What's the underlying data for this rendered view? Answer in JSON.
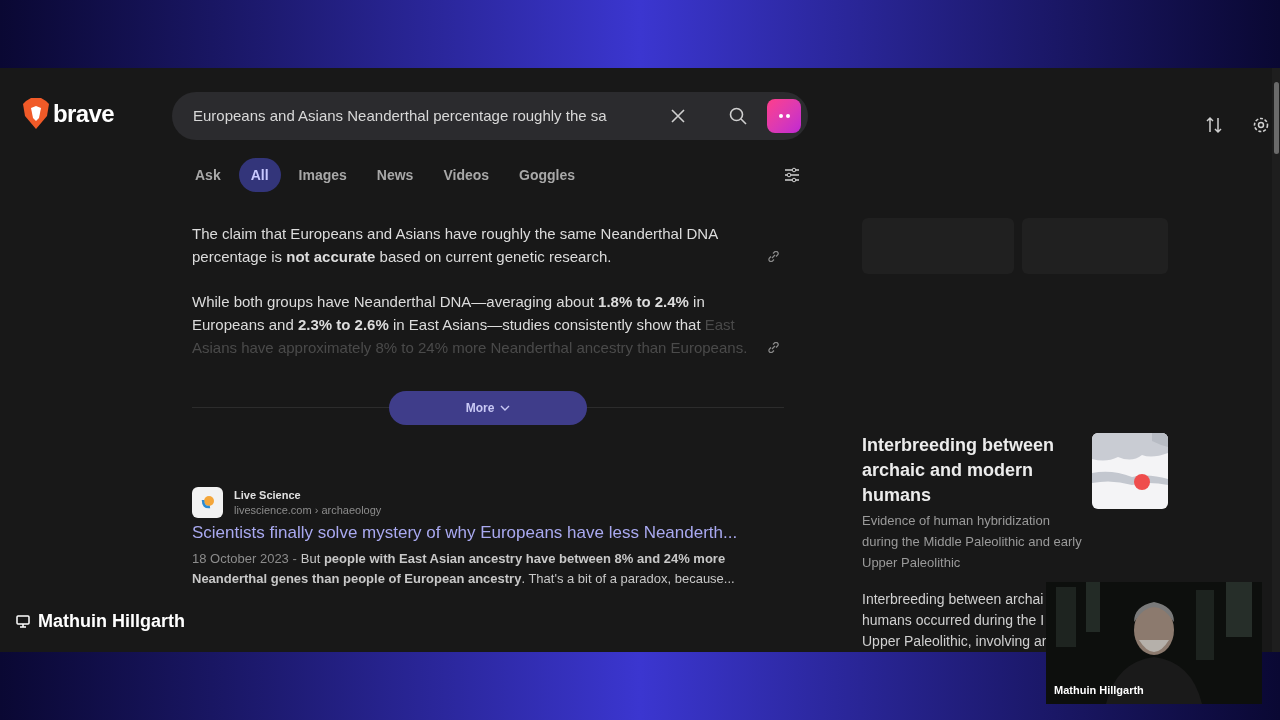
{
  "browser": {
    "logo_text": "brave",
    "search": {
      "value": "Europeans and Asians Neanderthal percentage roughly the sa"
    }
  },
  "tabs": [
    {
      "label": "Ask",
      "selected": false
    },
    {
      "label": "All",
      "selected": true
    },
    {
      "label": "Images",
      "selected": false
    },
    {
      "label": "News",
      "selected": false
    },
    {
      "label": "Videos",
      "selected": false
    },
    {
      "label": "Goggles",
      "selected": false
    }
  ],
  "answer": {
    "paragraphs": [
      {
        "text": "The claim that Europeans and Asians have roughly the same Neanderthal DNA percentage is **not accurate** based on current genetic research."
      },
      {
        "text": "While both groups have Neanderthal DNA—averaging about **1.8% to 2.4%** in Europeans and **2.3% to 2.6%** in East Asians—studies consistently show that",
        "faded_text": "East Asians have approximately 8% to 24% more Neanderthal ancestry than Europeans."
      }
    ],
    "more_button": "More"
  },
  "results": [
    {
      "site": "Live Science",
      "url": "livescience.com › archaeology",
      "title": "Scientists finally solve mystery of why Europeans have less Neanderth...",
      "date": "18 October 2023 -",
      "snippet": "But **people with East Asian ancestry have between 8% and 24% more Neanderthal genes than people of European ancestry**. That's a bit of a paradox, because..."
    }
  ],
  "knowledge_panel": {
    "title": "Interbreeding between archaic and modern humans",
    "subtitle": "Evidence of human hybridization during the Middle Paleolithic and early Upper Paleolithic",
    "body_lines": [
      "Interbreeding between archai",
      "humans occurred during the I",
      "Upper Paleolithic, involving ar"
    ]
  },
  "presenter": {
    "name": "Mathuin Hillgarth"
  },
  "webcam": {
    "name": "Mathuin Hillgarth"
  }
}
